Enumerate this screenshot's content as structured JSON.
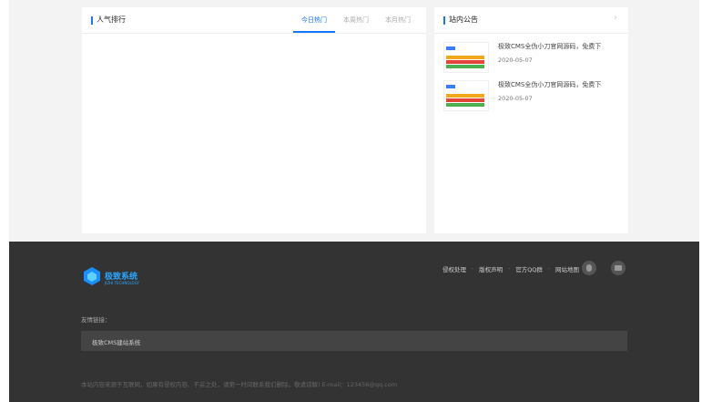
{
  "rank": {
    "title": "人气排行",
    "tabs": [
      {
        "label": "今日热门",
        "active": true
      },
      {
        "label": "本周热门",
        "active": false
      },
      {
        "label": "本月热门",
        "active": false
      }
    ]
  },
  "notice": {
    "title": "站内公告",
    "more_icon": "chevron-right-icon",
    "items": [
      {
        "title": "极致CMS全伪小刀官网源码，免费下",
        "date": "2020-05-07"
      },
      {
        "title": "极致CMS全伪小刀官网源码，免费下",
        "date": "2020-05-07"
      }
    ]
  },
  "footer": {
    "logo_text": "极致系统",
    "logo_sub": "JIZHI TECHNOLOGY",
    "nav": [
      "侵权处理",
      "版权声明",
      "官方QQ群",
      "网站地图"
    ],
    "friend_label": "友情链接：",
    "friend_links": [
      "极致CMS建站系统"
    ],
    "copyright": "本站内容来源于互联网，如果有侵权内容、不妥之处，请第一时间联系我们删除。敬请谅解! E-mail：123456@qq.com"
  },
  "colors": {
    "accent": "#1677ff",
    "footer_bg": "#333333"
  }
}
